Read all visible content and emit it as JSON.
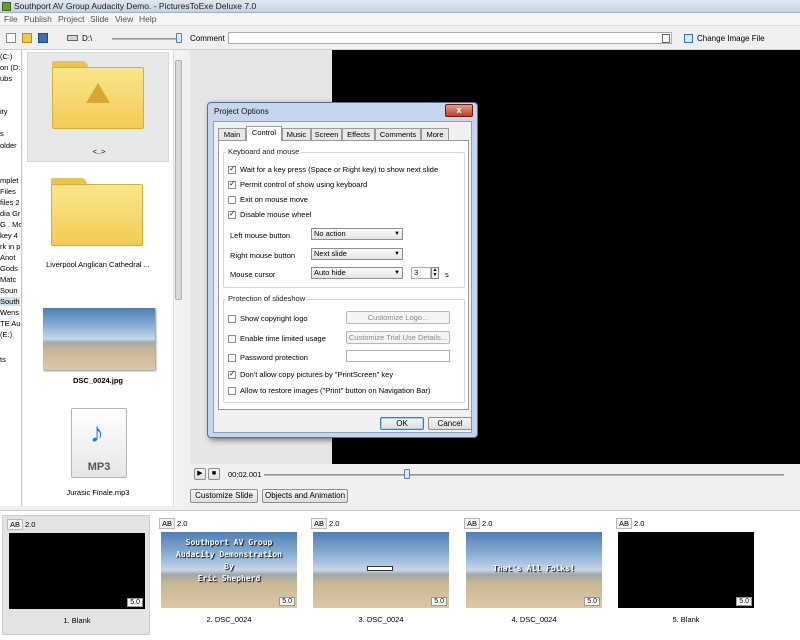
{
  "window": {
    "title": "Southport AV Group Audacity Demo. - PicturesToExe Deluxe 7.0"
  },
  "menu": [
    "File",
    "Publish",
    "Project",
    "Slide",
    "View",
    "Help"
  ],
  "toolbar": {
    "path": "D:\\",
    "comment_label": "Comment",
    "comment_value": "",
    "change_image_label": "Change Image File"
  },
  "tree": [
    "(C:)",
    "on (D:",
    "ubs",
    "",
    "ity",
    "",
    "s",
    "older",
    "",
    "",
    "mplet",
    "Files",
    "files 2",
    "dia Gr",
    "G . Mo",
    "key 4",
    "rk in p",
    "Anot",
    "Gods",
    "Matc",
    "Soun",
    "South",
    "Wens",
    "TE Au",
    "(E:)",
    "",
    "ts"
  ],
  "files": [
    {
      "label": "<..>",
      "kind": "up-folder"
    },
    {
      "label": "Liverpool Anglican Cathedral ...",
      "kind": "folder"
    },
    {
      "label": "DSC_0024.jpg",
      "kind": "image"
    },
    {
      "label": "Jurasic Finale.mp3",
      "kind": "audio",
      "badge": "MP3"
    }
  ],
  "preview": {
    "time": "00:02.001",
    "play_position": 0.27
  },
  "buttons": {
    "customize_slide": "Customize Slide",
    "objects_animation": "Objects and Animation"
  },
  "dialog": {
    "title": "Project Options",
    "close": "x",
    "tabs": [
      "Main",
      "Control",
      "Music",
      "Screen",
      "Effects",
      "Comments",
      "More"
    ],
    "active_tab": "Control",
    "keyboard_group": "Keyboard and mouse",
    "checks": [
      {
        "label": "Wait for a key press (Space or Right key) to show next slide",
        "checked": true
      },
      {
        "label": "Permit control of show using keyboard",
        "checked": true
      },
      {
        "label": "Exit on mouse move",
        "checked": false
      },
      {
        "label": "Disable mouse wheel",
        "checked": true
      }
    ],
    "left_mouse_label": "Left mouse button",
    "left_mouse_value": "No action",
    "right_mouse_label": "Right mouse button",
    "right_mouse_value": "Next slide",
    "cursor_label": "Mouse cursor",
    "cursor_value": "Auto hide",
    "cursor_seconds": "3",
    "cursor_unit": "s",
    "protection_group": "Protection of slideshow",
    "copyright_label": "Show copyright logo",
    "copyright_btn": "Customize Logo...",
    "timelimit_label": "Enable time limited usage",
    "timelimit_btn": "Customize Trial Use Details...",
    "password_label": "Password protection",
    "password_value": "",
    "printscreen_label": "Don't allow copy pictures by \"PrintScreen\" key",
    "printscreen_checked": true,
    "restore_label": "Allow to restore images (\"Print\" button on Navigation Bar)",
    "ok": "OK",
    "cancel": "Cancel"
  },
  "slides": [
    {
      "ab": "AB",
      "duration": "2.0",
      "tail": "5.0",
      "name": "1. Blank",
      "thumb": "black",
      "caption": []
    },
    {
      "ab": "AB",
      "duration": "2.0",
      "tail": "5.0",
      "name": "2. DSC_0024",
      "thumb": "beach",
      "caption": [
        "Southport AV Group",
        "Audacity Demonstration",
        "By",
        "Eric Shepherd"
      ]
    },
    {
      "ab": "AB",
      "duration": "2.0",
      "tail": "5.0",
      "name": "3. DSC_0024",
      "thumb": "beach",
      "caption": []
    },
    {
      "ab": "AB",
      "duration": "2.0",
      "tail": "5.0",
      "name": "4. DSC_0024",
      "thumb": "beach",
      "caption": [
        "That's All Folks!"
      ]
    },
    {
      "ab": "AB",
      "duration": "2.0",
      "tail": "5.0",
      "name": "5. Blank",
      "thumb": "black",
      "caption": []
    }
  ],
  "colors": {
    "selected_slide_bg": "#e3e3e3",
    "dialog_frame": "#c5d7ee",
    "folder": "#f1cc55"
  }
}
